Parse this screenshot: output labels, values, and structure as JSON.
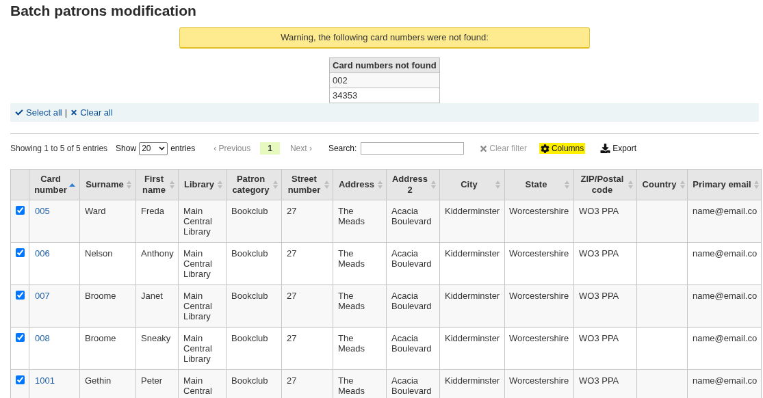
{
  "page_title": "Batch patrons modification",
  "warning": {
    "message": "Warning, the following card numbers were not found:"
  },
  "not_found_table": {
    "heading": "Card numbers not found",
    "rows": [
      "002",
      "34353"
    ]
  },
  "selection_bar": {
    "select_all": "Select all",
    "separator": "|",
    "clear_all": "Clear all"
  },
  "toolbar": {
    "info": "Showing 1 to 5 of 5 entries",
    "show_label": "Show",
    "page_size": "20",
    "entries_label": "entries",
    "pagination": [
      {
        "kind": "previous",
        "label": "‹ Previous",
        "disabled": true,
        "selected": false
      },
      {
        "kind": "page",
        "label": "1",
        "disabled": false,
        "selected": true
      },
      {
        "kind": "next",
        "label": "Next ›",
        "disabled": true,
        "selected": false
      }
    ],
    "search": {
      "label": "Search:"
    },
    "actions": [
      {
        "kind": "clear_filter",
        "label": "Clear filter",
        "disabled": true,
        "highlighted": false
      },
      {
        "kind": "columns",
        "label": "Columns",
        "disabled": false,
        "highlighted": true
      },
      {
        "kind": "export",
        "label": "Export",
        "disabled": false,
        "highlighted": false
      }
    ]
  },
  "table": {
    "columns": [
      {
        "label": "Card number",
        "sorted": true
      },
      {
        "label": "Surname",
        "sorted": false
      },
      {
        "label": "First name",
        "sorted": false
      },
      {
        "label": "Library",
        "sorted": false
      },
      {
        "label": "Patron category",
        "sorted": false
      },
      {
        "label": "Street number",
        "sorted": false
      },
      {
        "label": "Address",
        "sorted": false
      },
      {
        "label": "Address 2",
        "sorted": false
      },
      {
        "label": "City",
        "sorted": false
      },
      {
        "label": "State",
        "sorted": false
      },
      {
        "label": "ZIP/Postal code",
        "sorted": false
      },
      {
        "label": "Country",
        "sorted": false
      },
      {
        "label": "Primary email",
        "sorted": false
      }
    ],
    "rows": [
      {
        "checked": true,
        "card_number": "005",
        "surname": "Ward",
        "first_name": "Freda",
        "library": "Main Central Library",
        "patron_category": "Bookclub",
        "street_number": "27",
        "address": "The Meads",
        "address_2": "Acacia Boulevard",
        "city": "Kidderminster",
        "state": "Worcestershire",
        "zip_postal_code": "WO3 PPA",
        "primary_email": "name@email.co"
      },
      {
        "checked": true,
        "card_number": "006",
        "surname": "Nelson",
        "first_name": "Anthony",
        "library": "Main Central Library",
        "patron_category": "Bookclub",
        "street_number": "27",
        "address": "The Meads",
        "address_2": "Acacia Boulevard",
        "city": "Kidderminster",
        "state": "Worcestershire",
        "zip_postal_code": "WO3 PPA",
        "primary_email": "name@email.co"
      },
      {
        "checked": true,
        "card_number": "007",
        "surname": "Broome",
        "first_name": "Janet",
        "library": "Main Central Library",
        "patron_category": "Bookclub",
        "street_number": "27",
        "address": "The Meads",
        "address_2": "Acacia Boulevard",
        "city": "Kidderminster",
        "state": "Worcestershire",
        "zip_postal_code": "WO3 PPA",
        "primary_email": "name@email.co"
      },
      {
        "checked": true,
        "card_number": "008",
        "surname": "Broome",
        "first_name": "Sneaky",
        "library": "Main Central Library",
        "patron_category": "Bookclub",
        "street_number": "27",
        "address": "The Meads",
        "address_2": "Acacia Boulevard",
        "city": "Kidderminster",
        "state": "Worcestershire",
        "zip_postal_code": "WO3 PPA",
        "primary_email": "name@email.co"
      },
      {
        "checked": true,
        "card_number": "1001",
        "surname": "Gethin",
        "first_name": "Peter",
        "library": "Main Central",
        "patron_category": "Bookclub",
        "street_number": "27",
        "address": "The Meads",
        "address_2": "Acacia Boulevard",
        "city": "Kidderminster",
        "state": "Worcestershire",
        "zip_postal_code": "WO3 PPA",
        "primary_email": "name@email.co"
      }
    ]
  }
}
